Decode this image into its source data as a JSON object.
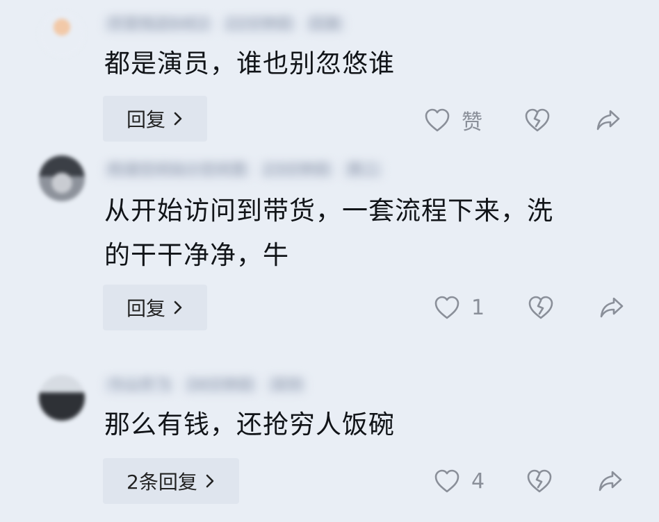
{
  "comments": [
    {
      "text": "都是演员，谁也别忽悠谁",
      "meta": [
        "宗室栈这64E2",
        "22分钟前",
        "回复"
      ],
      "reply_label": "回复",
      "like_count": "赞"
    },
    {
      "text_line1": "从开始访问到带货，一套流程下来，洗",
      "text_line2": "的干干净净，牛",
      "meta": [
        "和谐空间站小空间里",
        "23分钟前",
        "第二"
      ],
      "reply_label": "回复",
      "like_count": "1"
    },
    {
      "text": "那么有钱，还抢穷人饭碗",
      "meta": [
        "今山手飞",
        "34分钟前",
        "深圳"
      ],
      "reply_label": "2条回复",
      "like_count": "4"
    }
  ],
  "icons": {
    "like": "heart-outline-icon",
    "dislike": "broken-heart-icon",
    "share": "share-arrow-icon",
    "chevron": "chevron-right-icon"
  },
  "colors": {
    "background": "#e9eef5",
    "reply_bg": "#dfe5ee",
    "text": "#111418",
    "muted": "#8a8f99"
  }
}
